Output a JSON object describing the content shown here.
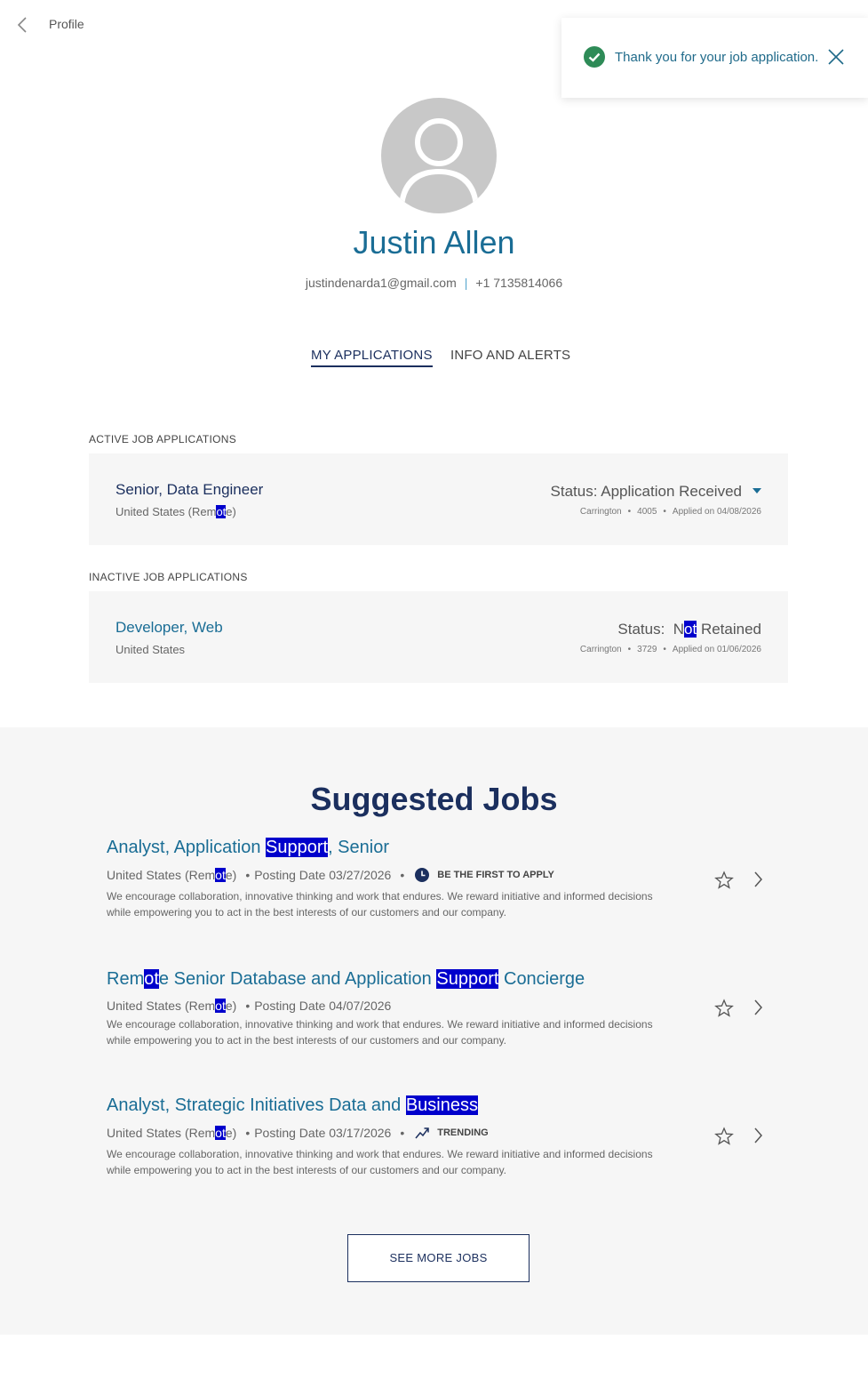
{
  "header": {
    "title": "Profile"
  },
  "toast": {
    "message": "Thank you for your job application."
  },
  "profile": {
    "name": "Justin Allen",
    "email": "justindenarda1@gmail.com",
    "separator": "|",
    "phone": "+1 7135814066"
  },
  "tabs": [
    {
      "label": "MY APPLICATIONS",
      "active": true
    },
    {
      "label": "INFO AND ALERTS",
      "active": false
    }
  ],
  "active_section": {
    "label": "ACTIVE JOB APPLICATIONS",
    "application": {
      "title": "Senior, Data Engineer",
      "loc_pre": "United States (Rem",
      "loc_hl": "ot",
      "loc_post": "e)",
      "status": "Status: Application Received",
      "company": "Carrington",
      "req_id": "4005",
      "applied": "Applied on 04/08/2026"
    }
  },
  "inactive_section": {
    "label": "INACTIVE JOB APPLICATIONS",
    "application": {
      "title": "Developer, Web",
      "location": "United States",
      "status_pre": "Status:  N",
      "status_hl": "ot",
      "status_post": " Retained",
      "company": "Carrington",
      "req_id": "3729",
      "applied": "Applied on 01/06/2026"
    }
  },
  "suggested": {
    "title": "Suggested Jobs",
    "jobs": [
      {
        "title_a": "Analyst, Application ",
        "title_hl": "Support",
        "title_b": ", Senior",
        "title_hl2": "",
        "title_c": "",
        "loc_pre": "United States (Rem",
        "loc_hl": "ot",
        "loc_post": "e)",
        "posting": "Posting Date 03/27/2026",
        "badge": "BE THE FIRST TO APPLY",
        "badge_icon": "clock-icon",
        "desc": "We encourage collaboration, innovative thinking and work that endures. We reward initiative and informed decisions while empowering you to act in the best interests of our customers and our company."
      },
      {
        "title_a": "Rem",
        "title_hl": "ot",
        "title_b": "e Senior Database and Application ",
        "title_hl2": "Support",
        "title_c": " Concierge",
        "loc_pre": "United States (Rem",
        "loc_hl": "ot",
        "loc_post": "e)",
        "posting": "Posting Date 04/07/2026",
        "badge": "",
        "badge_icon": "",
        "desc": "We encourage collaboration, innovative thinking and work that endures. We reward initiative and informed decisions while empowering you to act in the best interests of our customers and our company."
      },
      {
        "title_a": "Analyst, Strategic Initiatives Data and ",
        "title_hl": "Business",
        "title_b": "",
        "title_hl2": "",
        "title_c": "",
        "loc_pre": "United States (Rem",
        "loc_hl": "ot",
        "loc_post": "e)",
        "posting": "Posting Date 03/17/2026",
        "badge": "TRENDING",
        "badge_icon": "trending-icon",
        "desc": "We encourage collaboration, innovative thinking and work that endures. We reward initiative and informed decisions while empowering you to act in the best interests of our customers and our company."
      }
    ],
    "see_more": "SEE MORE JOBS"
  },
  "colors": {
    "brand_blue": "#1a6d95",
    "navy": "#1b2f5e",
    "success_green": "#2e8b57",
    "highlight": "#0000cc"
  }
}
